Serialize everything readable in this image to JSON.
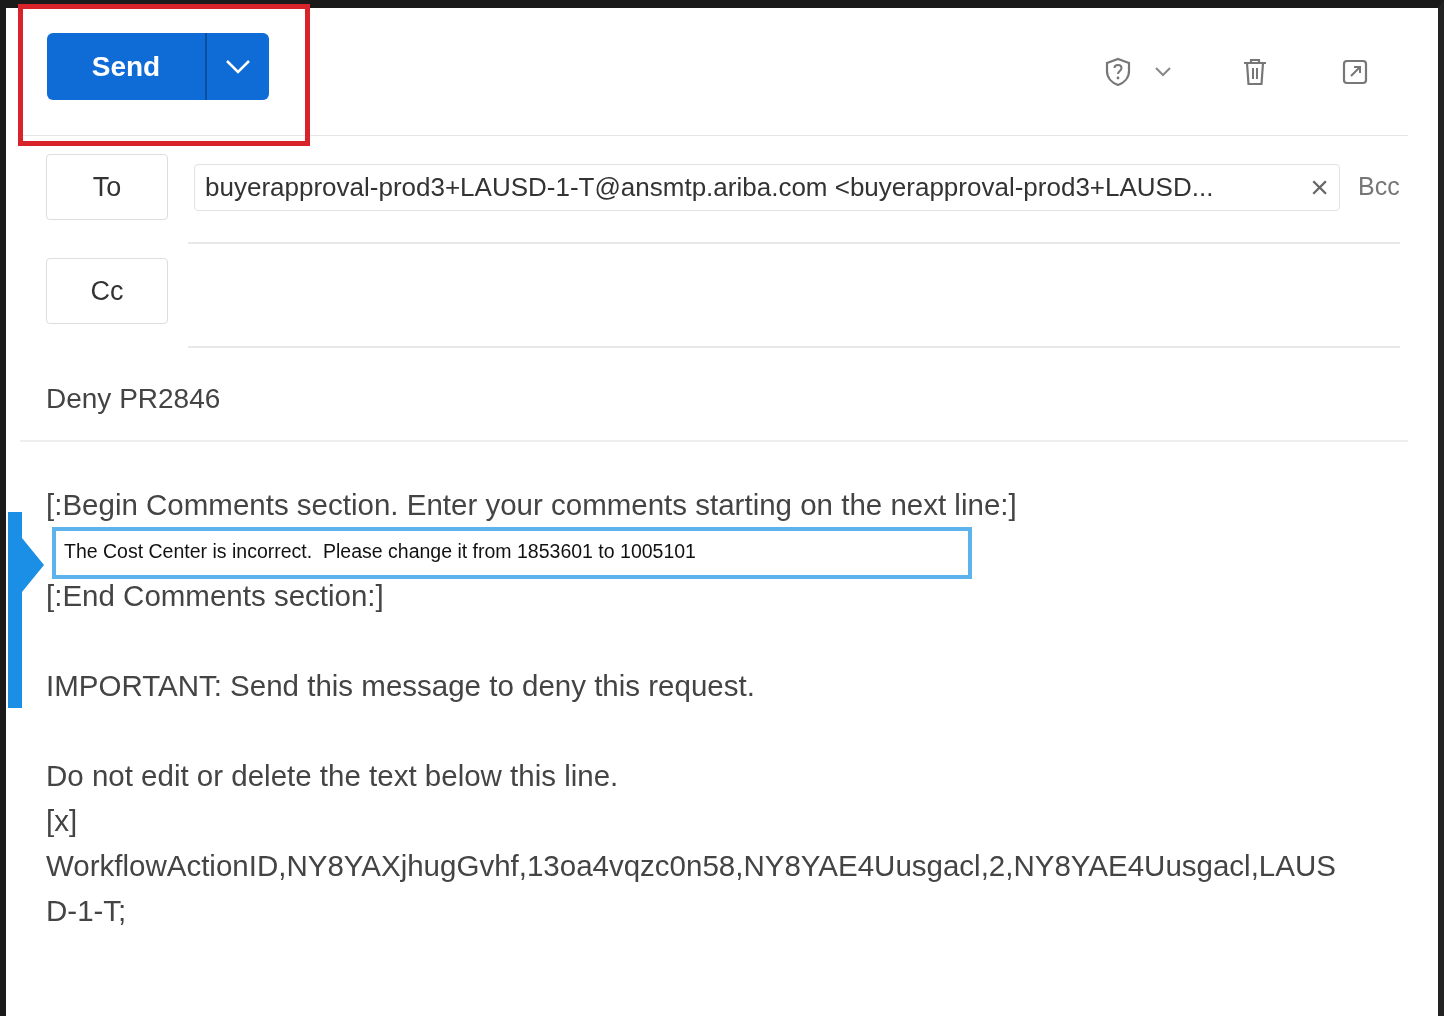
{
  "toolbar": {
    "send": {
      "label": "Send"
    }
  },
  "to": {
    "label": "To",
    "recipient": "buyerapproval-prod3+LAUSD-1-T@ansmtp.ariba.com <buyerapproval-prod3+LAUSD...",
    "remove": "×",
    "bcc": "Bcc"
  },
  "cc": {
    "label": "Cc"
  },
  "subject": "Deny PR2846",
  "body": [
    {
      "kind": "text",
      "text": "[:Begin Comments section. Enter your comments starting on the next line:]"
    },
    {
      "kind": "comment",
      "text": "The Cost Center is incorrect.  Please change it from 1853601 to 1005101"
    },
    {
      "kind": "text",
      "text": "[:End Comments section:]"
    },
    {
      "kind": "blank"
    },
    {
      "kind": "text",
      "text": "IMPORTANT: Send this message to deny this request."
    },
    {
      "kind": "blank"
    },
    {
      "kind": "text",
      "text": "Do not edit or delete the text below this line."
    },
    {
      "kind": "text",
      "text": "[x]"
    },
    {
      "kind": "text",
      "text": "WorkflowActionID,NY8YAXjhugGvhf,13oa4vqzc0n58,NY8YAE4Uusgacl,2,NY8YAE4Uusgacl,LAUS"
    },
    {
      "kind": "text",
      "text": "D-1-T;"
    }
  ]
}
